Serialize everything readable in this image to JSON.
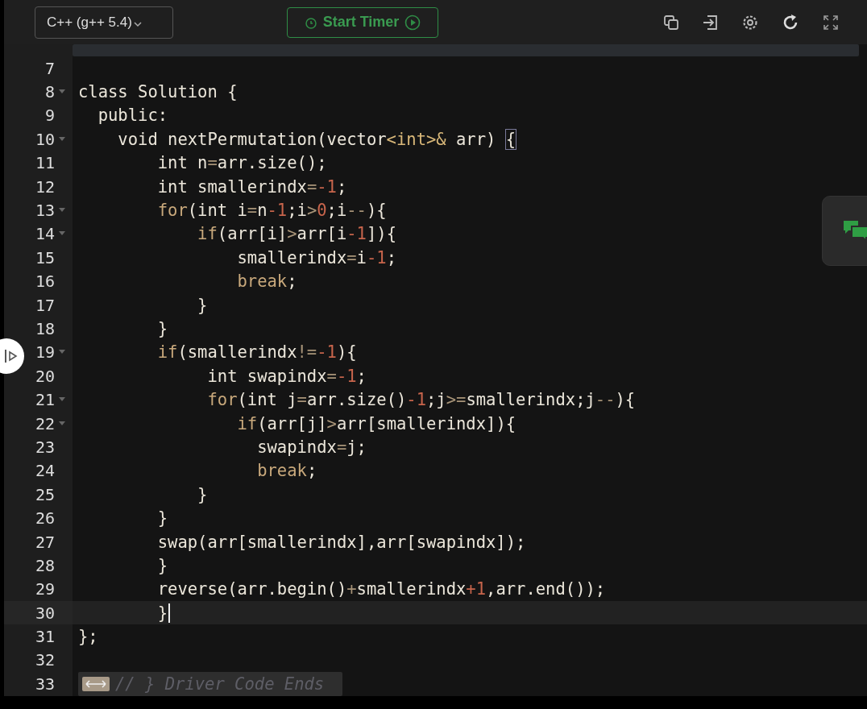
{
  "toolbar": {
    "language": "C++ (g++ 5.4)",
    "timer_button": "Start Timer"
  },
  "editor": {
    "lines": [
      {
        "number": "7",
        "foldable": false,
        "active": false
      },
      {
        "number": "8",
        "foldable": true,
        "active": false,
        "segments": [
          {
            "text": "class Solution {",
            "kind": "plain"
          }
        ]
      },
      {
        "number": "9",
        "foldable": false,
        "active": false,
        "segments": [
          {
            "text": "  public:",
            "kind": "plain"
          }
        ]
      },
      {
        "number": "10",
        "foldable": true,
        "active": false,
        "segments": [
          {
            "text": "    void nextPermutation(vector",
            "kind": "plain"
          },
          {
            "text": "<int>&",
            "kind": "type"
          },
          {
            "text": " arr) ",
            "kind": "plain"
          },
          {
            "text": "{",
            "kind": "bracket"
          }
        ]
      },
      {
        "number": "11",
        "foldable": false,
        "active": false,
        "segments": [
          {
            "text": "        int n",
            "kind": "plain"
          },
          {
            "text": "=",
            "kind": "op"
          },
          {
            "text": "arr.size();",
            "kind": "plain"
          }
        ]
      },
      {
        "number": "12",
        "foldable": false,
        "active": false,
        "segments": [
          {
            "text": "        int smallerindx",
            "kind": "plain"
          },
          {
            "text": "=",
            "kind": "op"
          },
          {
            "text": "-1",
            "kind": "number"
          },
          {
            "text": ";",
            "kind": "plain"
          }
        ]
      },
      {
        "number": "13",
        "foldable": true,
        "active": false,
        "segments": [
          {
            "text": "        for",
            "kind": "keyword"
          },
          {
            "text": "(int i",
            "kind": "plain"
          },
          {
            "text": "=",
            "kind": "op"
          },
          {
            "text": "n",
            "kind": "plain"
          },
          {
            "text": "-1",
            "kind": "number"
          },
          {
            "text": ";i",
            "kind": "plain"
          },
          {
            "text": ">",
            "kind": "op"
          },
          {
            "text": "0",
            "kind": "number"
          },
          {
            "text": ";i",
            "kind": "plain"
          },
          {
            "text": "--",
            "kind": "op"
          },
          {
            "text": "){",
            "kind": "plain"
          }
        ]
      },
      {
        "number": "14",
        "foldable": true,
        "active": false,
        "segments": [
          {
            "text": "            if",
            "kind": "keyword"
          },
          {
            "text": "(arr[i]",
            "kind": "plain"
          },
          {
            "text": ">",
            "kind": "op"
          },
          {
            "text": "arr[i",
            "kind": "plain"
          },
          {
            "text": "-1",
            "kind": "number"
          },
          {
            "text": "]){",
            "kind": "plain"
          }
        ]
      },
      {
        "number": "15",
        "foldable": false,
        "active": false,
        "segments": [
          {
            "text": "                smallerindx",
            "kind": "plain"
          },
          {
            "text": "=",
            "kind": "op"
          },
          {
            "text": "i",
            "kind": "plain"
          },
          {
            "text": "-1",
            "kind": "number"
          },
          {
            "text": ";",
            "kind": "plain"
          }
        ]
      },
      {
        "number": "16",
        "foldable": false,
        "active": false,
        "segments": [
          {
            "text": "                break",
            "kind": "keyword"
          },
          {
            "text": ";",
            "kind": "plain"
          }
        ]
      },
      {
        "number": "17",
        "foldable": false,
        "active": false,
        "segments": [
          {
            "text": "            }",
            "kind": "plain"
          }
        ]
      },
      {
        "number": "18",
        "foldable": false,
        "active": false,
        "segments": [
          {
            "text": "        }",
            "kind": "plain"
          }
        ]
      },
      {
        "number": "19",
        "foldable": true,
        "active": false,
        "segments": [
          {
            "text": "        if",
            "kind": "keyword"
          },
          {
            "text": "(smallerindx",
            "kind": "plain"
          },
          {
            "text": "!=",
            "kind": "op"
          },
          {
            "text": "-1",
            "kind": "number"
          },
          {
            "text": "){",
            "kind": "plain"
          }
        ]
      },
      {
        "number": "20",
        "foldable": false,
        "active": false,
        "segments": [
          {
            "text": "             int swapindx",
            "kind": "plain"
          },
          {
            "text": "=",
            "kind": "op"
          },
          {
            "text": "-1",
            "kind": "number"
          },
          {
            "text": ";",
            "kind": "plain"
          }
        ]
      },
      {
        "number": "21",
        "foldable": true,
        "active": false,
        "segments": [
          {
            "text": "             for",
            "kind": "keyword"
          },
          {
            "text": "(int j",
            "kind": "plain"
          },
          {
            "text": "=",
            "kind": "op"
          },
          {
            "text": "arr.size()",
            "kind": "plain"
          },
          {
            "text": "-1",
            "kind": "number"
          },
          {
            "text": ";j",
            "kind": "plain"
          },
          {
            "text": ">=",
            "kind": "op"
          },
          {
            "text": "smallerindx;j",
            "kind": "plain"
          },
          {
            "text": "--",
            "kind": "op"
          },
          {
            "text": "){",
            "kind": "plain"
          }
        ]
      },
      {
        "number": "22",
        "foldable": true,
        "active": false,
        "segments": [
          {
            "text": "                if",
            "kind": "keyword"
          },
          {
            "text": "(arr[j]",
            "kind": "plain"
          },
          {
            "text": ">",
            "kind": "op"
          },
          {
            "text": "arr[smallerindx]){",
            "kind": "plain"
          }
        ]
      },
      {
        "number": "23",
        "foldable": false,
        "active": false,
        "segments": [
          {
            "text": "                  swapindx",
            "kind": "plain"
          },
          {
            "text": "=",
            "kind": "op"
          },
          {
            "text": "j;",
            "kind": "plain"
          }
        ]
      },
      {
        "number": "24",
        "foldable": false,
        "active": false,
        "segments": [
          {
            "text": "                  break",
            "kind": "keyword"
          },
          {
            "text": ";",
            "kind": "plain"
          }
        ]
      },
      {
        "number": "25",
        "foldable": false,
        "active": false,
        "segments": [
          {
            "text": "            }",
            "kind": "plain"
          }
        ]
      },
      {
        "number": "26",
        "foldable": false,
        "active": false,
        "segments": [
          {
            "text": "        }",
            "kind": "plain"
          }
        ]
      },
      {
        "number": "27",
        "foldable": false,
        "active": false,
        "segments": [
          {
            "text": "        swap(arr[smallerindx],arr[swapindx]);",
            "kind": "plain"
          }
        ]
      },
      {
        "number": "28",
        "foldable": false,
        "active": false,
        "segments": [
          {
            "text": "        }",
            "kind": "plain"
          }
        ]
      },
      {
        "number": "29",
        "foldable": false,
        "active": false,
        "segments": [
          {
            "text": "        reverse(arr.begin()",
            "kind": "plain"
          },
          {
            "text": "+",
            "kind": "op"
          },
          {
            "text": "smallerindx",
            "kind": "plain"
          },
          {
            "text": "+1",
            "kind": "number"
          },
          {
            "text": ",arr.end());",
            "kind": "plain"
          }
        ]
      },
      {
        "number": "30",
        "foldable": false,
        "active": true,
        "segments": [
          {
            "text": "        }",
            "kind": "plain"
          }
        ]
      },
      {
        "number": "31",
        "foldable": false,
        "active": false,
        "segments": [
          {
            "text": "};",
            "kind": "plain"
          }
        ]
      },
      {
        "number": "32",
        "foldable": false,
        "active": false
      }
    ],
    "folded_end": {
      "number": "33",
      "text": "// } Driver Code Ends"
    }
  }
}
